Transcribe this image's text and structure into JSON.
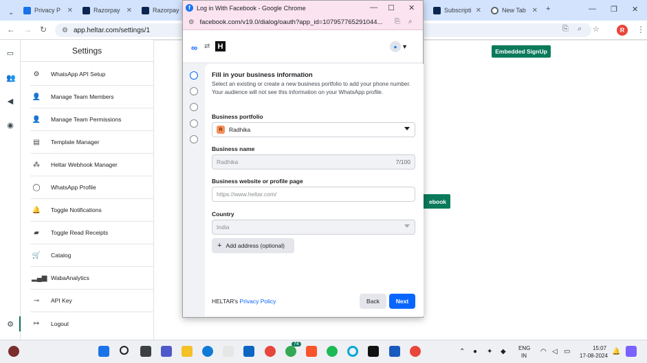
{
  "browser": {
    "tabs": [
      {
        "label": "Privacy P",
        "color": "#1a73e8"
      },
      {
        "label": "Razorpay",
        "color": "#0c2651"
      },
      {
        "label": "Razorpay",
        "color": "#0c2651"
      },
      {
        "label": "Subscripti",
        "color": "#0c2651"
      },
      {
        "label": "New Tab",
        "color": "#5f6368"
      }
    ],
    "url": "app.heltar.com/settings/1",
    "profile_initial": "R"
  },
  "sidebar": {
    "title": "Settings",
    "items": [
      {
        "label": "WhatsApp API Setup",
        "icon": "gear-chat-icon"
      },
      {
        "label": "Manage Team Members",
        "icon": "person-add-icon"
      },
      {
        "label": "Manage Team Permissions",
        "icon": "person-key-icon"
      },
      {
        "label": "Template Manager",
        "icon": "document-icon"
      },
      {
        "label": "Heltar Webhook Manager",
        "icon": "webhook-icon"
      },
      {
        "label": "WhatsApp Profile",
        "icon": "whatsapp-icon"
      },
      {
        "label": "Toggle Notifications",
        "icon": "bell-icon"
      },
      {
        "label": "Toggle Read Receipts",
        "icon": "receipt-icon"
      },
      {
        "label": "Catalog",
        "icon": "cart-icon"
      },
      {
        "label": "WabaAnalytics",
        "icon": "bar-chart-icon"
      },
      {
        "label": "API Key",
        "icon": "key-icon"
      },
      {
        "label": "Logout",
        "icon": "logout-icon"
      }
    ]
  },
  "main": {
    "embedded_signup_label": "Embedded SignUp",
    "facebook_button_label": "ebook"
  },
  "popup": {
    "window_title": "Log in With Facebook - Google Chrome",
    "url": "facebook.com/v19.0/dialog/oauth?app_id=107957765291044...",
    "form": {
      "title": "Fill in your business information",
      "description": "Select an existing or create a new business portfolio to add your phone number. Your audience will not see this information on your WhatsApp profile.",
      "portfolio_label": "Business portfolio",
      "portfolio_initial": "R",
      "portfolio_value": "Radhika",
      "name_label": "Business name",
      "name_value": "Radhika",
      "name_counter": "7/100",
      "website_label": "Business website or profile page",
      "website_placeholder": "https://www.heltar.com/",
      "country_label": "Country",
      "country_value": "India",
      "add_address_label": "Add address (optional)",
      "footer_prefix": "HELTAR's",
      "footer_link": "Privacy Policy",
      "back_label": "Back",
      "next_label": "Next"
    }
  },
  "taskbar": {
    "language": "ENG",
    "region": "IN",
    "time": "15:07",
    "date": "17-08-2024",
    "badge_count": "74"
  },
  "colors": {
    "brand_green": "#0b7a5b",
    "facebook_blue": "#0866ff"
  }
}
